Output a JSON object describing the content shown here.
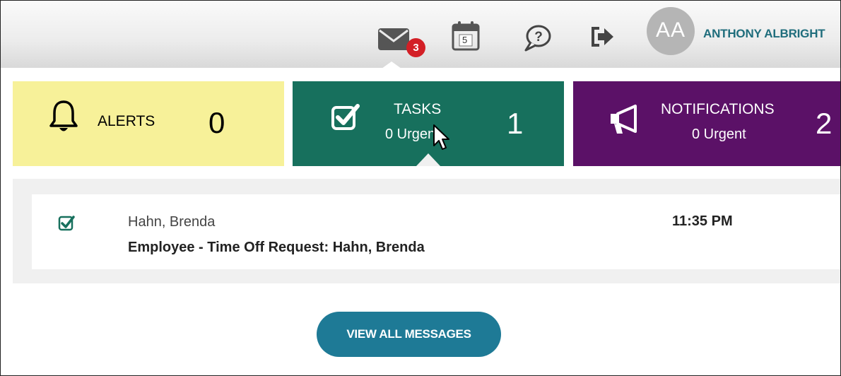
{
  "header": {
    "mail_badge_count": "3",
    "calendar_day": "5",
    "avatar_initials": "AA",
    "user_name": "ANTHONY ALBRIGHT"
  },
  "tiles": {
    "alerts": {
      "label": "ALERTS",
      "count": "0"
    },
    "tasks": {
      "label": "TASKS",
      "sub": "0 Urgent",
      "count": "1"
    },
    "notifications": {
      "label": "NOTIFICATIONS",
      "sub": "0 Urgent",
      "count": "2"
    }
  },
  "messages": [
    {
      "sender": "Hahn, Brenda",
      "subject": "Employee - Time Off Request: Hahn, Brenda",
      "time": "11:35 PM"
    }
  ],
  "actions": {
    "view_all_label": "VIEW ALL MESSAGES"
  },
  "icons": {
    "mail": "mail-icon",
    "calendar": "calendar-icon",
    "help": "help-chat-icon",
    "logout": "logout-icon",
    "bell": "bell-icon",
    "checkbox": "checkbox-icon",
    "megaphone": "megaphone-icon",
    "task_check": "task-check-icon"
  },
  "colors": {
    "alerts_bg": "#f7f199",
    "tasks_bg": "#17705d",
    "notifications_bg": "#5b1167",
    "badge": "#d31f26",
    "accent": "#1e7a96",
    "username": "#1f6d7c"
  }
}
